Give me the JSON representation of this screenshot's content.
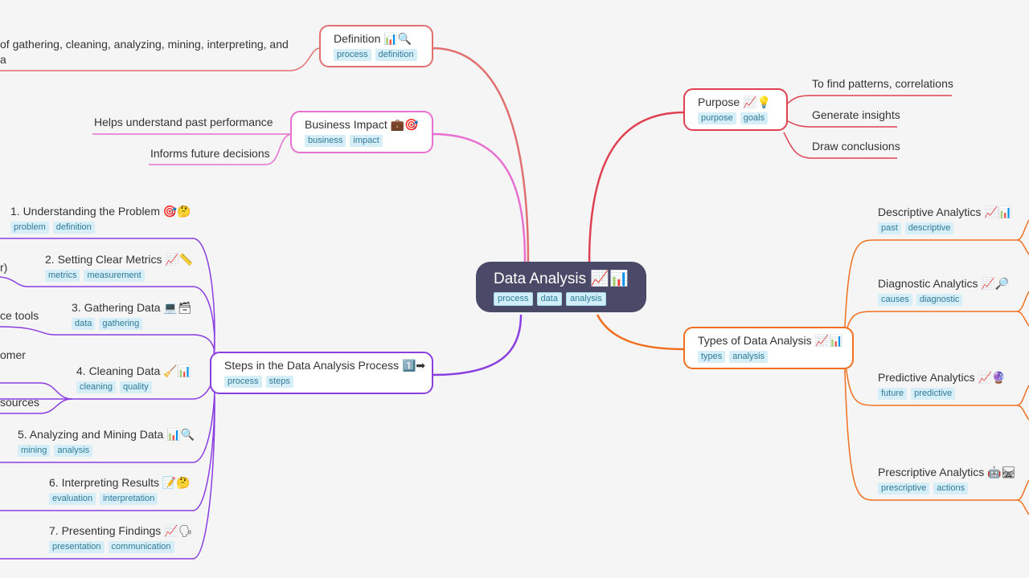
{
  "root": {
    "title": "Data Analysis 📈📊",
    "tags": [
      "process",
      "data",
      "analysis"
    ]
  },
  "colors": {
    "definition": "#e07070",
    "business": "#e870d0",
    "steps": "#8a3ee0",
    "purpose": "#e04050",
    "types": "#f07020",
    "root_bg": "#4a4a68",
    "tag_bg": "#d6eef7",
    "tag_text": "#2f7a99"
  },
  "definition": {
    "title": "Definition 📊🔍",
    "tags": [
      "process",
      "definition"
    ],
    "leaves": [
      "of gathering, cleaning, analyzing, mining, interpreting, and",
      "a"
    ]
  },
  "business": {
    "title": "Business Impact 💼🎯",
    "tags": [
      "business",
      "impact"
    ],
    "leaves": [
      "Helps understand past performance",
      "Informs future decisions"
    ]
  },
  "steps": {
    "title": "Steps in the Data Analysis Process 1️⃣➡",
    "tags": [
      "process",
      "steps"
    ],
    "items": [
      {
        "title": "1. Understanding the Problem 🎯🤔",
        "tags": [
          "problem",
          "definition"
        ]
      },
      {
        "title": "2. Setting Clear Metrics 📈📏",
        "tags": [
          "metrics",
          "measurement"
        ]
      },
      {
        "title": "3. Gathering Data 💻🗃",
        "tags": [
          "data",
          "gathering"
        ]
      },
      {
        "title": "4. Cleaning Data 🧹📊",
        "tags": [
          "cleaning",
          "quality"
        ]
      },
      {
        "title": "5. Analyzing and Mining Data 📊🔍",
        "tags": [
          "mining",
          "analysis"
        ]
      },
      {
        "title": "6. Interpreting Results 📝🤔",
        "tags": [
          "evaluation",
          "interpretation"
        ]
      },
      {
        "title": "7. Presenting Findings 📈🗣",
        "tags": [
          "presentation",
          "communication"
        ]
      }
    ],
    "partial_leaves": [
      "r)",
      "ce tools",
      "omer",
      "sources"
    ]
  },
  "purpose": {
    "title": "Purpose 📈💡",
    "tags": [
      "purpose",
      "goals"
    ],
    "leaves": [
      "To find patterns, correlations",
      "Generate insights",
      "Draw conclusions"
    ]
  },
  "types": {
    "title": "Types of Data Analysis 📈📊",
    "tags": [
      "types",
      "analysis"
    ],
    "items": [
      {
        "title": "Descriptive Analytics 📈📊",
        "tags": [
          "past",
          "descriptive"
        ]
      },
      {
        "title": "Diagnostic Analytics 📈🔎",
        "tags": [
          "causes",
          "diagnostic"
        ]
      },
      {
        "title": "Predictive Analytics 📈🔮",
        "tags": [
          "future",
          "predictive"
        ]
      },
      {
        "title": "Prescriptive Analytics 🤖🛤",
        "tags": [
          "prescriptive",
          "actions"
        ]
      }
    ]
  }
}
